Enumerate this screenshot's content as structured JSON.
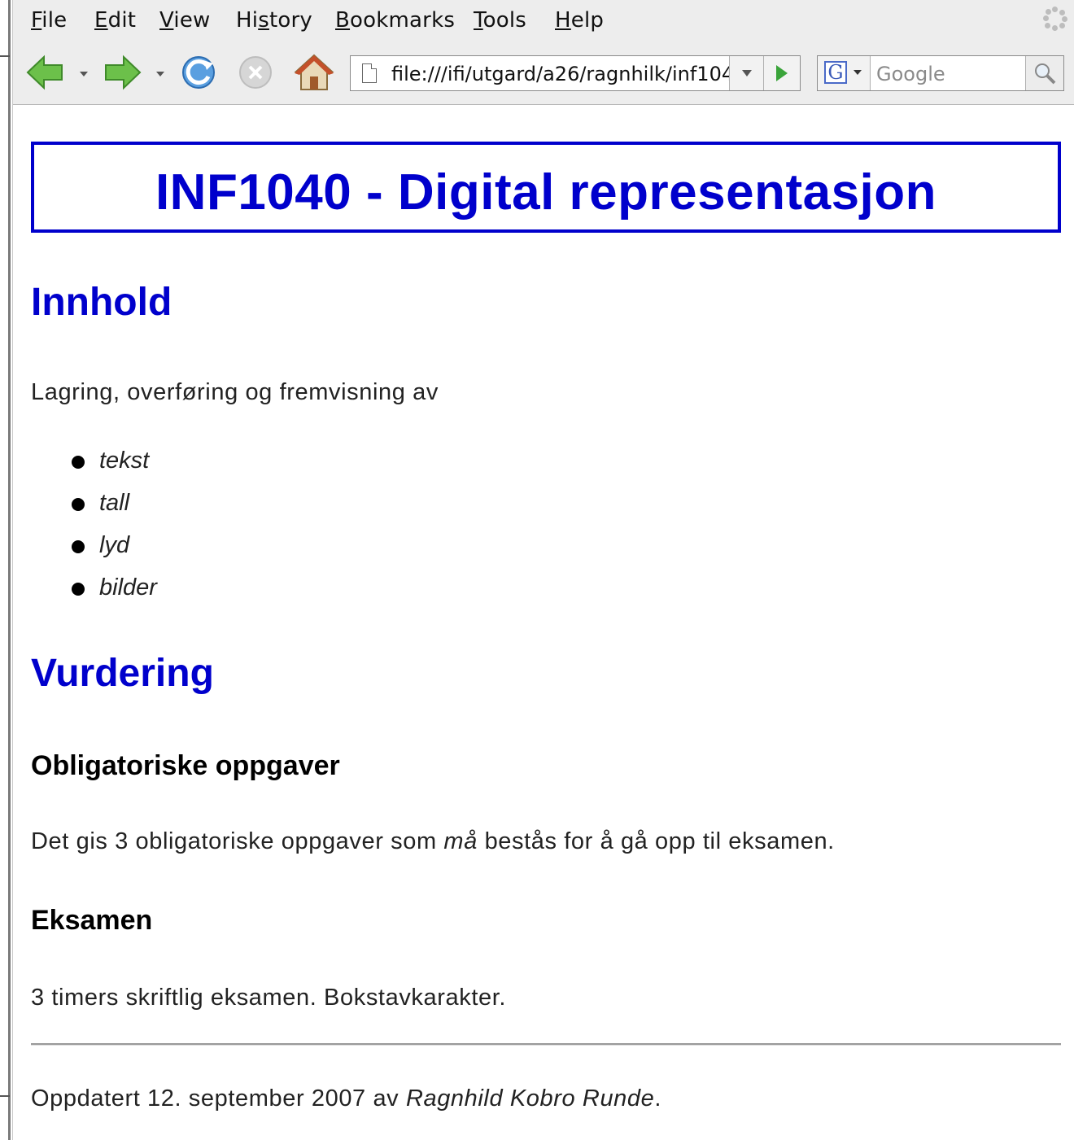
{
  "browser": {
    "menu": [
      {
        "label": "File",
        "accel": "F"
      },
      {
        "label": "Edit",
        "accel": "E"
      },
      {
        "label": "View",
        "accel": "V"
      },
      {
        "label": "History",
        "accel": "s"
      },
      {
        "label": "Bookmarks",
        "accel": "B"
      },
      {
        "label": "Tools",
        "accel": "T"
      },
      {
        "label": "Help",
        "accel": "H"
      }
    ],
    "address": "file:///ifi/utgard/a26/ragnhilk/inf104",
    "search_engine_letter": "G",
    "search_placeholder": "Google"
  },
  "page": {
    "title": "INF1040 - Digital representasjon",
    "section1": {
      "heading": "Innhold",
      "intro": "Lagring, overføring og fremvisning av",
      "items": [
        "tekst",
        "tall",
        "lyd",
        "bilder"
      ]
    },
    "section2": {
      "heading": "Vurdering",
      "sub1": {
        "heading": "Obligatoriske oppgaver",
        "text_before": "Det gis 3 obligatoriske oppgaver som ",
        "text_em": "må",
        "text_after": " bestås for å gå opp til eksamen."
      },
      "sub2": {
        "heading": "Eksamen",
        "text": "3 timers skriftlig eksamen. Bokstavkarakter."
      }
    },
    "footer": {
      "text_before": "Oppdatert 12. september 2007 av ",
      "author": "Ragnhild Kobro Runde",
      "text_after": "."
    }
  },
  "colors": {
    "heading_blue": "#0000cc",
    "chrome_bg": "#ededed",
    "text": "#222222"
  }
}
